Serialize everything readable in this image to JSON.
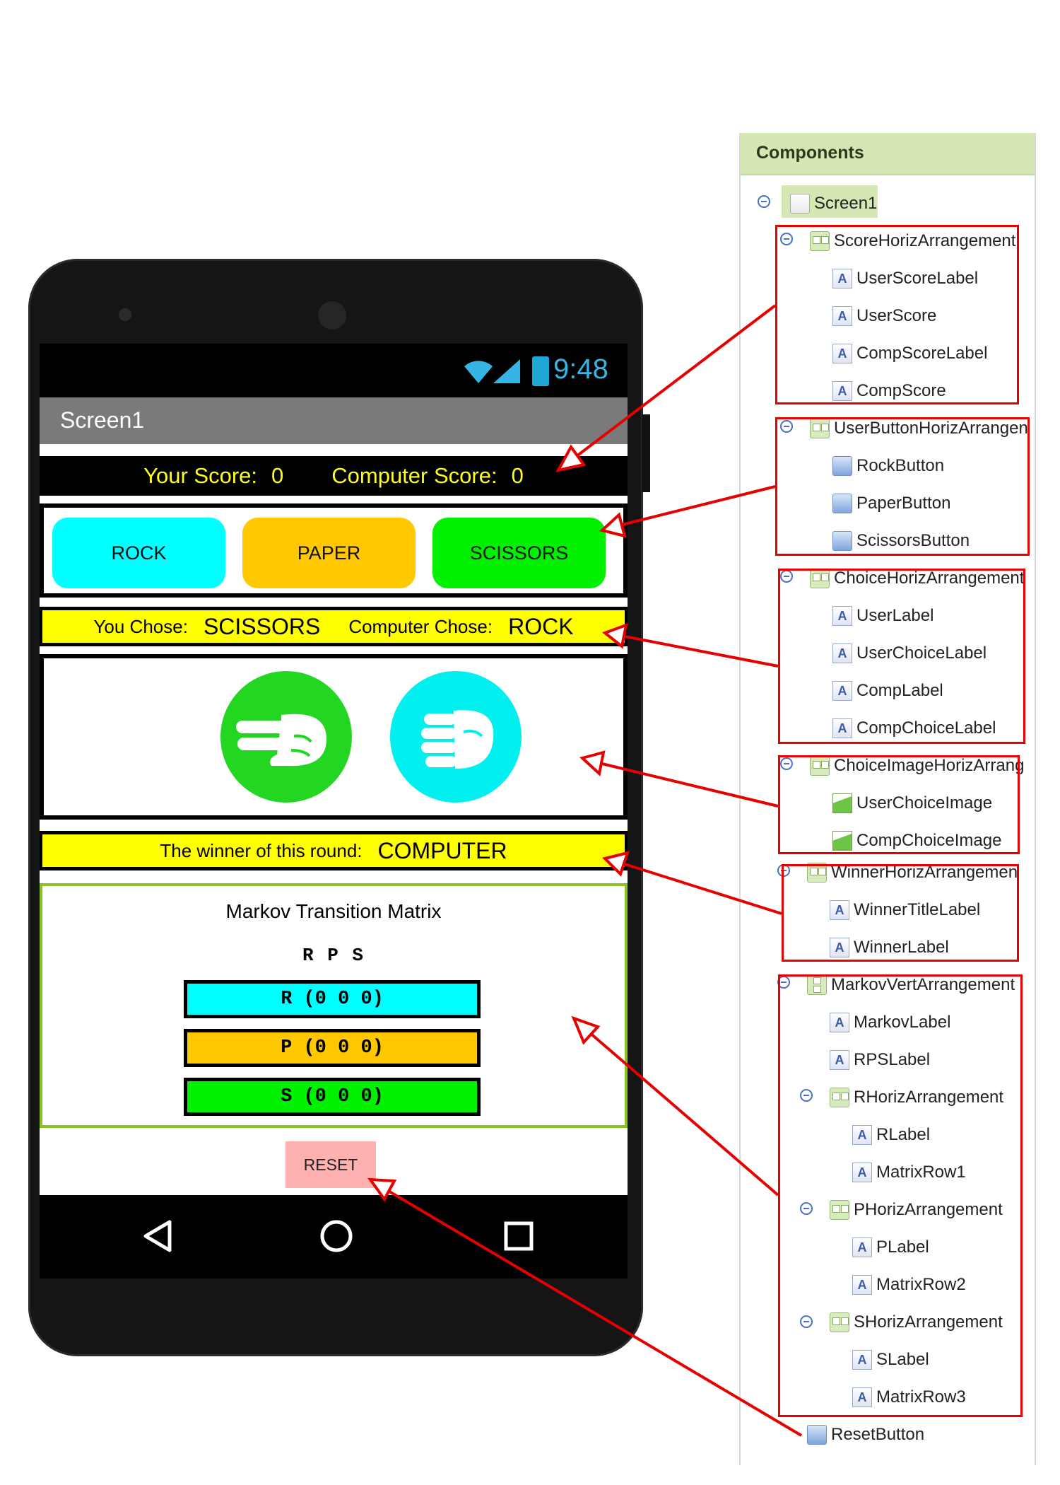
{
  "status_bar": {
    "time": "9:48"
  },
  "app": {
    "screen_title": "Screen1",
    "score": {
      "user_label": "Your Score:",
      "user_value": "0",
      "comp_label": "Computer Score:",
      "comp_value": "0"
    },
    "buttons": {
      "rock": "ROCK",
      "paper": "PAPER",
      "scissors": "SCISSORS"
    },
    "choice": {
      "user_label": "You Chose:",
      "user_value": "SCISSORS",
      "comp_label": "Computer Chose:",
      "comp_value": "ROCK"
    },
    "winner": {
      "label": "The winner of this round:",
      "value": "COMPUTER"
    },
    "markov": {
      "title": "Markov Transition Matrix",
      "header": "R P S",
      "row1": "R (0 0 0)",
      "row2": "P (0 0 0)",
      "row3": "S (0 0 0)"
    },
    "reset": "RESET"
  },
  "panel": {
    "title": "Components",
    "items": [
      {
        "label": "Screen1",
        "icon": "screen-icon"
      },
      {
        "label": "ScoreHorizArrangement",
        "icon": "horizontal-arrangement-icon"
      },
      {
        "label": "UserScoreLabel",
        "icon": "label-icon"
      },
      {
        "label": "UserScore",
        "icon": "label-icon"
      },
      {
        "label": "CompScoreLabel",
        "icon": "label-icon"
      },
      {
        "label": "CompScore",
        "icon": "label-icon"
      },
      {
        "label": "UserButtonHorizArrangen",
        "icon": "horizontal-arrangement-icon"
      },
      {
        "label": "RockButton",
        "icon": "button-icon"
      },
      {
        "label": "PaperButton",
        "icon": "button-icon"
      },
      {
        "label": "ScissorsButton",
        "icon": "button-icon"
      },
      {
        "label": "ChoiceHorizArrangement",
        "icon": "horizontal-arrangement-icon"
      },
      {
        "label": "UserLabel",
        "icon": "label-icon"
      },
      {
        "label": "UserChoiceLabel",
        "icon": "label-icon"
      },
      {
        "label": "CompLabel",
        "icon": "label-icon"
      },
      {
        "label": "CompChoiceLabel",
        "icon": "label-icon"
      },
      {
        "label": "ChoiceImageHorizArrang",
        "icon": "horizontal-arrangement-icon"
      },
      {
        "label": "UserChoiceImage",
        "icon": "image-icon"
      },
      {
        "label": "CompChoiceImage",
        "icon": "image-icon"
      },
      {
        "label": "WinnerHorizArrangemen",
        "icon": "horizontal-arrangement-icon"
      },
      {
        "label": "WinnerTitleLabel",
        "icon": "label-icon"
      },
      {
        "label": "WinnerLabel",
        "icon": "label-icon"
      },
      {
        "label": "MarkovVertArrangement",
        "icon": "vertical-arrangement-icon"
      },
      {
        "label": "MarkovLabel",
        "icon": "label-icon"
      },
      {
        "label": "RPSLabel",
        "icon": "label-icon"
      },
      {
        "label": "RHorizArrangement",
        "icon": "horizontal-arrangement-icon"
      },
      {
        "label": "RLabel",
        "icon": "label-icon"
      },
      {
        "label": "MatrixRow1",
        "icon": "label-icon"
      },
      {
        "label": "PHorizArrangement",
        "icon": "horizontal-arrangement-icon"
      },
      {
        "label": "PLabel",
        "icon": "label-icon"
      },
      {
        "label": "MatrixRow2",
        "icon": "label-icon"
      },
      {
        "label": "SHorizArrangement",
        "icon": "horizontal-arrangement-icon"
      },
      {
        "label": "SLabel",
        "icon": "label-icon"
      },
      {
        "label": "MatrixRow3",
        "icon": "label-icon"
      },
      {
        "label": "ResetButton",
        "icon": "button-icon"
      }
    ]
  },
  "colors": {
    "annotation_red": "#e60000",
    "rock": "#00ffff",
    "paper": "#ffc800",
    "scissors": "#00f000",
    "highlight_yellow": "#ffff00",
    "score_text": "#ffff1a",
    "reset": "#ffb0b0",
    "panel_header": "#d5e8b4"
  }
}
